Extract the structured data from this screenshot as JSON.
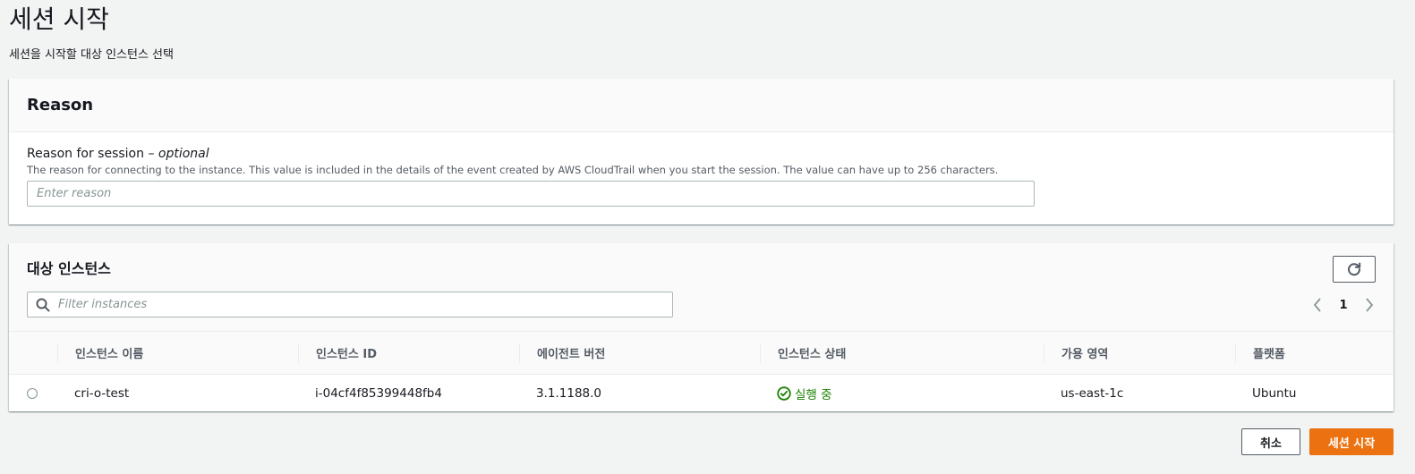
{
  "page": {
    "title": "세션 시작",
    "subtitle": "세션을 시작할 대상 인스턴스 선택"
  },
  "reason_panel": {
    "title": "Reason",
    "field_label": "Reason for session",
    "field_label_separator": " – ",
    "field_label_optional": "optional",
    "description": "The reason for connecting to the instance. This value is included in the details of the event created by AWS CloudTrail when you start the session. The value can have up to 256 characters.",
    "input_placeholder": "Enter reason",
    "input_value": ""
  },
  "instances_panel": {
    "title": "대상 인스턴스",
    "filter_placeholder": "Filter instances",
    "filter_value": "",
    "refresh_icon": "refresh-icon",
    "pagination": {
      "current_page": "1",
      "prev_icon": "chevron-left-icon",
      "next_icon": "chevron-right-icon"
    },
    "columns": [
      "인스턴스 이름",
      "인스턴스 ID",
      "에이전트 버전",
      "인스턴스 상태",
      "가용 영역",
      "플랫폼"
    ],
    "rows": [
      {
        "name": "cri-o-test",
        "instance_id": "i-04cf4f85399448fb4",
        "agent_version": "3.1.1188.0",
        "status": "실행 중",
        "status_icon": "check-circle-icon",
        "availability_zone": "us-east-1c",
        "platform": "Ubuntu",
        "selected": false
      }
    ]
  },
  "footer": {
    "cancel_label": "취소",
    "start_label": "세션 시작"
  },
  "colors": {
    "background": "#f2f3f3",
    "primary_button": "#ec7211",
    "status_success": "#1d8102",
    "text_secondary": "#545b64"
  }
}
